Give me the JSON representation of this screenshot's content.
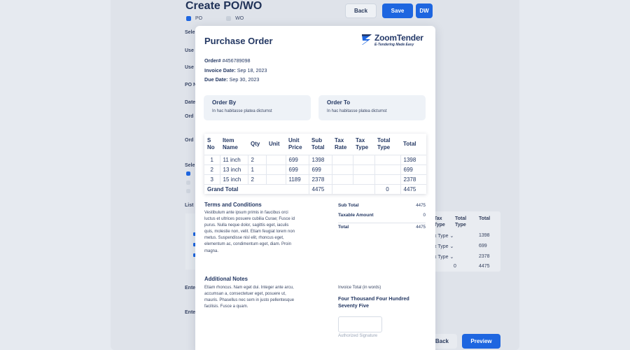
{
  "app": {
    "title": "Create PO/WO",
    "buttons": {
      "back": "Back",
      "save": "Save",
      "dw": "DW",
      "preview": "Preview",
      "back_bottom": "Back"
    },
    "radio": {
      "po": "PO",
      "wo": "WO",
      "selected": "PO"
    },
    "labels": {
      "l1": "Sele",
      "l2": "Use",
      "l3": "Use",
      "l4": "PO N",
      "l5": "Date",
      "l6": "Ord",
      "l7": "Ord",
      "l8": "Sele",
      "l9": "List",
      "l10": "Ente",
      "l11": "Ente"
    },
    "bg_table": {
      "headers": [
        "Tax Type",
        "Total Type",
        "Total"
      ],
      "rows": [
        {
          "tax_type": "x Type",
          "total": "1398"
        },
        {
          "tax_type": "x Type",
          "total": "699"
        },
        {
          "tax_type": "x Type",
          "total": "2378"
        },
        {
          "tax_type": "",
          "total_type": "0",
          "total": "4475"
        }
      ]
    }
  },
  "modal": {
    "title": "Purchase Order",
    "logo": {
      "name": "ZoomTender",
      "tagline": "E-Tendering Made Easy"
    },
    "order_no_label": "Order#",
    "order_no": "#456789098",
    "invoice_date_label": "Invoice Date:",
    "invoice_date": "Sep 18, 2023",
    "due_date_label": "Due Date:",
    "due_date": "Sep 30, 2023",
    "order_by": {
      "heading": "Order By",
      "text": "In hac habitasse platea dictumst"
    },
    "order_to": {
      "heading": "Order To",
      "text": "In hac habitasse platea dictumst"
    },
    "table": {
      "headers": [
        "S No",
        "Item Name",
        "Qty",
        "Unit",
        "Unit Price",
        "Sub Total",
        "Tax Rate",
        "Tax Type",
        "Total Type",
        "Total"
      ],
      "rows": [
        [
          "1",
          "11 inch",
          "2",
          "",
          "699",
          "1398",
          "",
          "",
          "",
          "1398"
        ],
        [
          "2",
          "13 inch",
          "1",
          "",
          "699",
          "699",
          "",
          "",
          "",
          "699"
        ],
        [
          "3",
          "15 inch",
          "2",
          "",
          "1189",
          "2378",
          "",
          "",
          "",
          "2378"
        ]
      ],
      "grand_total_label": "Grand Total",
      "grand_subtotal": "4475",
      "grand_total_type": "0",
      "grand_total": "4475"
    },
    "terms": {
      "heading": "Terms and Conditions",
      "text": "Vestibulum ante ipsum primis in faucibus orci luctus et ultrices posuere cubilia Curae; Fusce id purus. Nulla neque dolor, sagittis eget, iaculis quis, molestie non, velit. Etiam feugiat lorem non metus. Suspendisse nisl elit, rhoncus eget, elementum ac, condimentum eget, diam. Proin magna."
    },
    "notes": {
      "heading": "Additional Notes",
      "text": "Etiam rhoncus. Nam eget dui. Integer ante arcu, accumsan a, consectetuer eget, posuere ut, mauris. Phasellus nec sem in justo pellentesque facilisis. Fusce a quam."
    },
    "summary": {
      "sub_total_label": "Sub Total",
      "sub_total": "4475",
      "taxable_label": "Taxable Amount",
      "taxable": "0",
      "total_label": "Total",
      "total": "4475"
    },
    "words": {
      "label": "Invoice Total (in words)",
      "value": "Four Thousand Four Hundred Seventy Five"
    },
    "signature_label": "Authorized Signature"
  }
}
